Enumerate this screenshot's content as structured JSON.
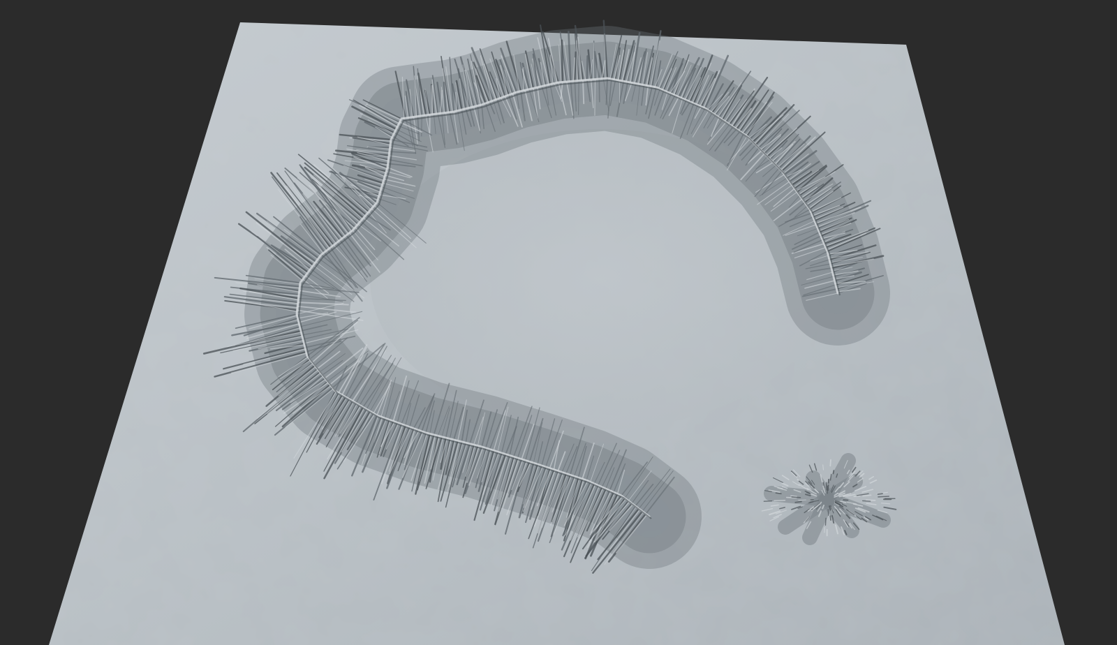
{
  "viewport": {
    "background_color": "#2b2b2b"
  },
  "terrain": {
    "surface_color": "#b7bec3",
    "surface_highlight_color": "#c4cacf",
    "ridge_light_color": "#d3d8dc",
    "ridge_shadow_color": "#4a5156",
    "ridge_mid_color": "#7d858b",
    "features": [
      {
        "kind": "crater-rim-ridge",
        "shape": "open-ring"
      },
      {
        "kind": "small-ridge-cluster",
        "shape": "star"
      }
    ]
  }
}
